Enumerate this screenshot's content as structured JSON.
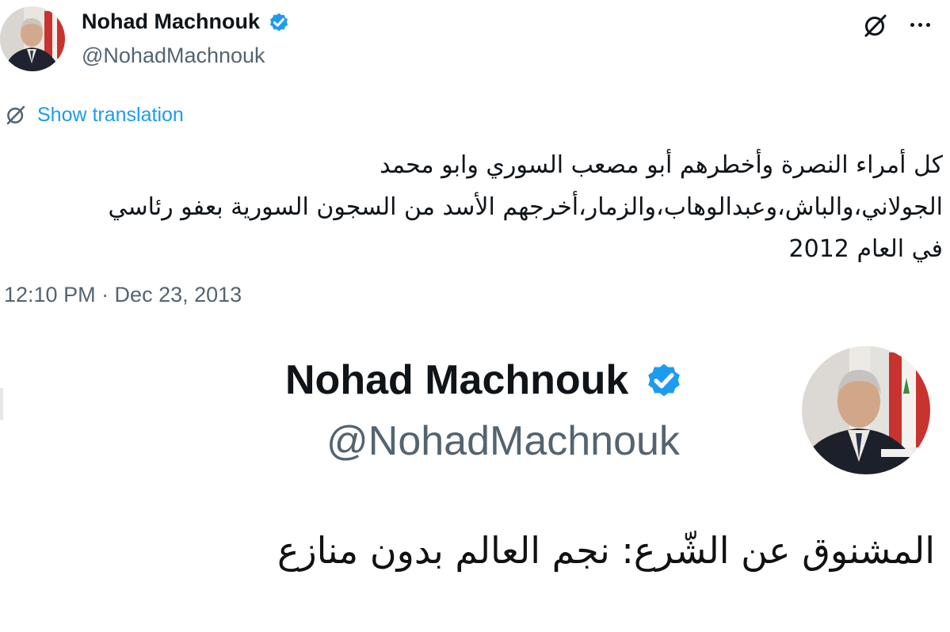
{
  "colors": {
    "accent": "#1d9bf0",
    "text": "#0f1419",
    "secondary": "#536471",
    "verified": "#1d9bf0"
  },
  "top_tweet": {
    "author": {
      "name": "Nohad Machnouk",
      "handle": "@NohadMachnouk",
      "verified": true,
      "avatar_icon": "profile-photo"
    },
    "actions": {
      "grok_icon": "grok-icon",
      "more_icon": "more-icon"
    },
    "translation": {
      "icon": "grok-icon",
      "label": "Show translation"
    },
    "text_lines": [
      "كل أمراء النصرة وأخطرهم أبو مصعب السوري وابو محمد",
      "الجولاني،والباش،وعبدالوهاب،والزمار،أخرجهم الأسد من السجون السورية بعفو رئاسي",
      "في العام 2012"
    ],
    "timestamp": "12:10 PM · Dec 23, 2013"
  },
  "zoomed_header": {
    "name": "Nohad Machnouk",
    "handle": "@NohadMachnouk",
    "verified": true,
    "avatar_icon": "profile-photo"
  },
  "caption": "المشنوق عن الشّرع: نجم العالم بدون منازع"
}
